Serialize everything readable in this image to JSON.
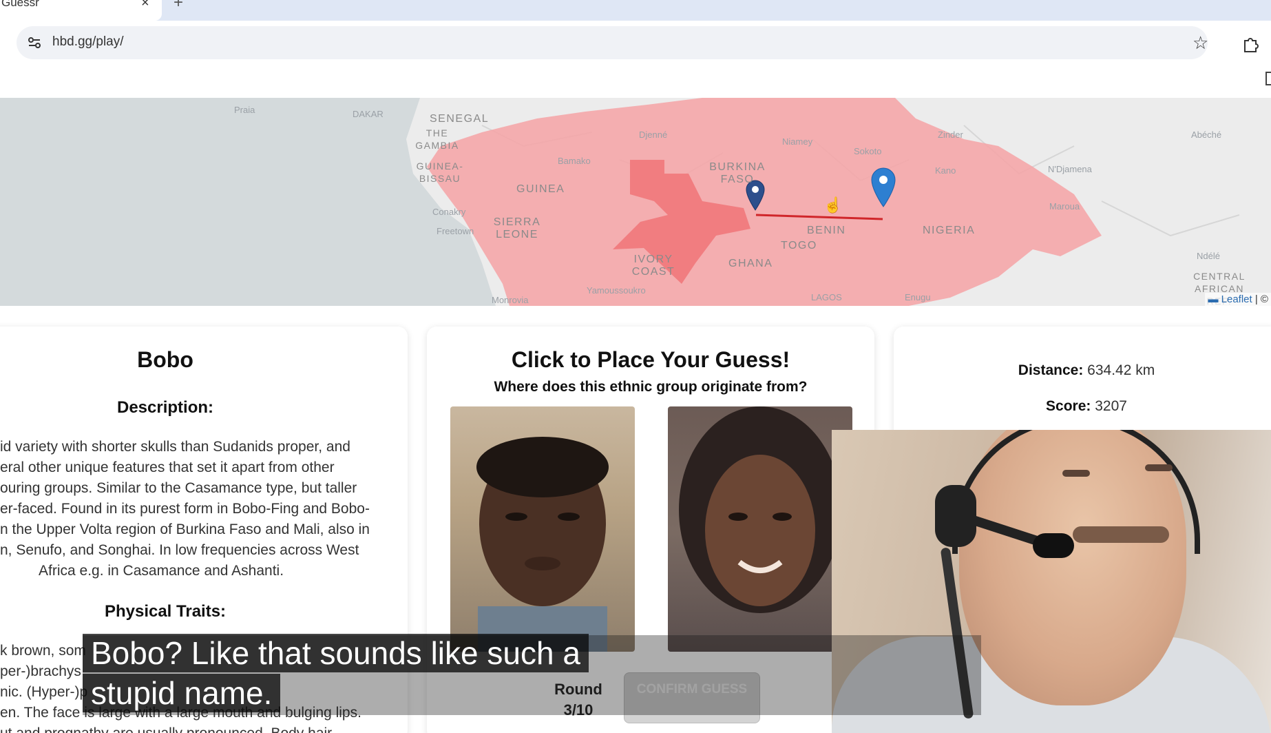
{
  "browser": {
    "tab_title": "Guessr",
    "url": "hbd.gg/play/",
    "icons": [
      "site-settings-icon",
      "star-icon",
      "extensions-icon",
      "close-icon",
      "plus-icon"
    ]
  },
  "map": {
    "labels": {
      "praia": "Praia",
      "dakar": "DAKAR",
      "senegal": "SENEGAL",
      "gambia": "THE GAMBIA",
      "guinea_bissau": "GUINEA-BISSAU",
      "guinea": "GUINEA",
      "conakry": "Conakry",
      "freetown": "Freetown",
      "sierra_leone": "SIERRA LEONE",
      "monrovia": "Monrovia",
      "djenne": "Djenné",
      "bamako": "Bamako",
      "burkina": "BURKINA FASO",
      "ivory_coast": "IVORY COAST",
      "yamoussoukro": "Yamoussoukro",
      "ghana": "GHANA",
      "togo": "TOGO",
      "benin": "BENIN",
      "lagos": "LAGOS",
      "niamey": "Niamey",
      "sokoto": "Sokoto",
      "zinder": "Zinder",
      "kano": "Kano",
      "nigeria": "NIGERIA",
      "enugu": "Enugu",
      "ndjamena": "N'Djamena",
      "maroua": "Maroua",
      "abeche": "Abéché",
      "ndele": "Ndélé",
      "car": "CENTRAL AFRICAN REP."
    },
    "attribution_leaflet": "Leaflet",
    "colors": {
      "region": "#f6a3a6",
      "region_core": "#f07a7d",
      "line": "#d0262a",
      "marker": "#2d7fd1"
    }
  },
  "ethnic": {
    "name": "Bobo",
    "description_heading": "Description:",
    "description_lines": [
      "id variety with shorter skulls than Sudanids proper, and",
      "eral other unique features that set it apart from other",
      "ouring groups. Similar to the Casamance type, but taller",
      "er-faced. Found in its purest form in Bobo-Fing and Bobo-",
      "n the Upper Volta region of Burkina Faso and Mali, also in",
      "n, Senufo, and Songhai. In low frequencies across West",
      "Africa e.g. in Casamance and Ashanti."
    ],
    "traits_heading": "Physical Traits:",
    "traits_lines": [
      "k brown, som",
      "per-)brachys",
      "nic. (Hyper-)p",
      "en. The face is large with a large mouth and bulging lips.",
      "ut and prognathy are usually pronounced. Body hair"
    ]
  },
  "guess": {
    "title": "Click to Place Your Guess!",
    "subtitle": "Where does this ethnic group originate from?",
    "round_label": "Round",
    "round_value": "3/10",
    "confirm_label": "CONFIRM GUESS"
  },
  "result": {
    "distance_label": "Distance:",
    "distance_value": "634.42 km",
    "score_label": "Score:",
    "score_value": "3207"
  },
  "captions": {
    "line1": "Bobo? Like that sounds like such a",
    "line2": "stupid name."
  }
}
